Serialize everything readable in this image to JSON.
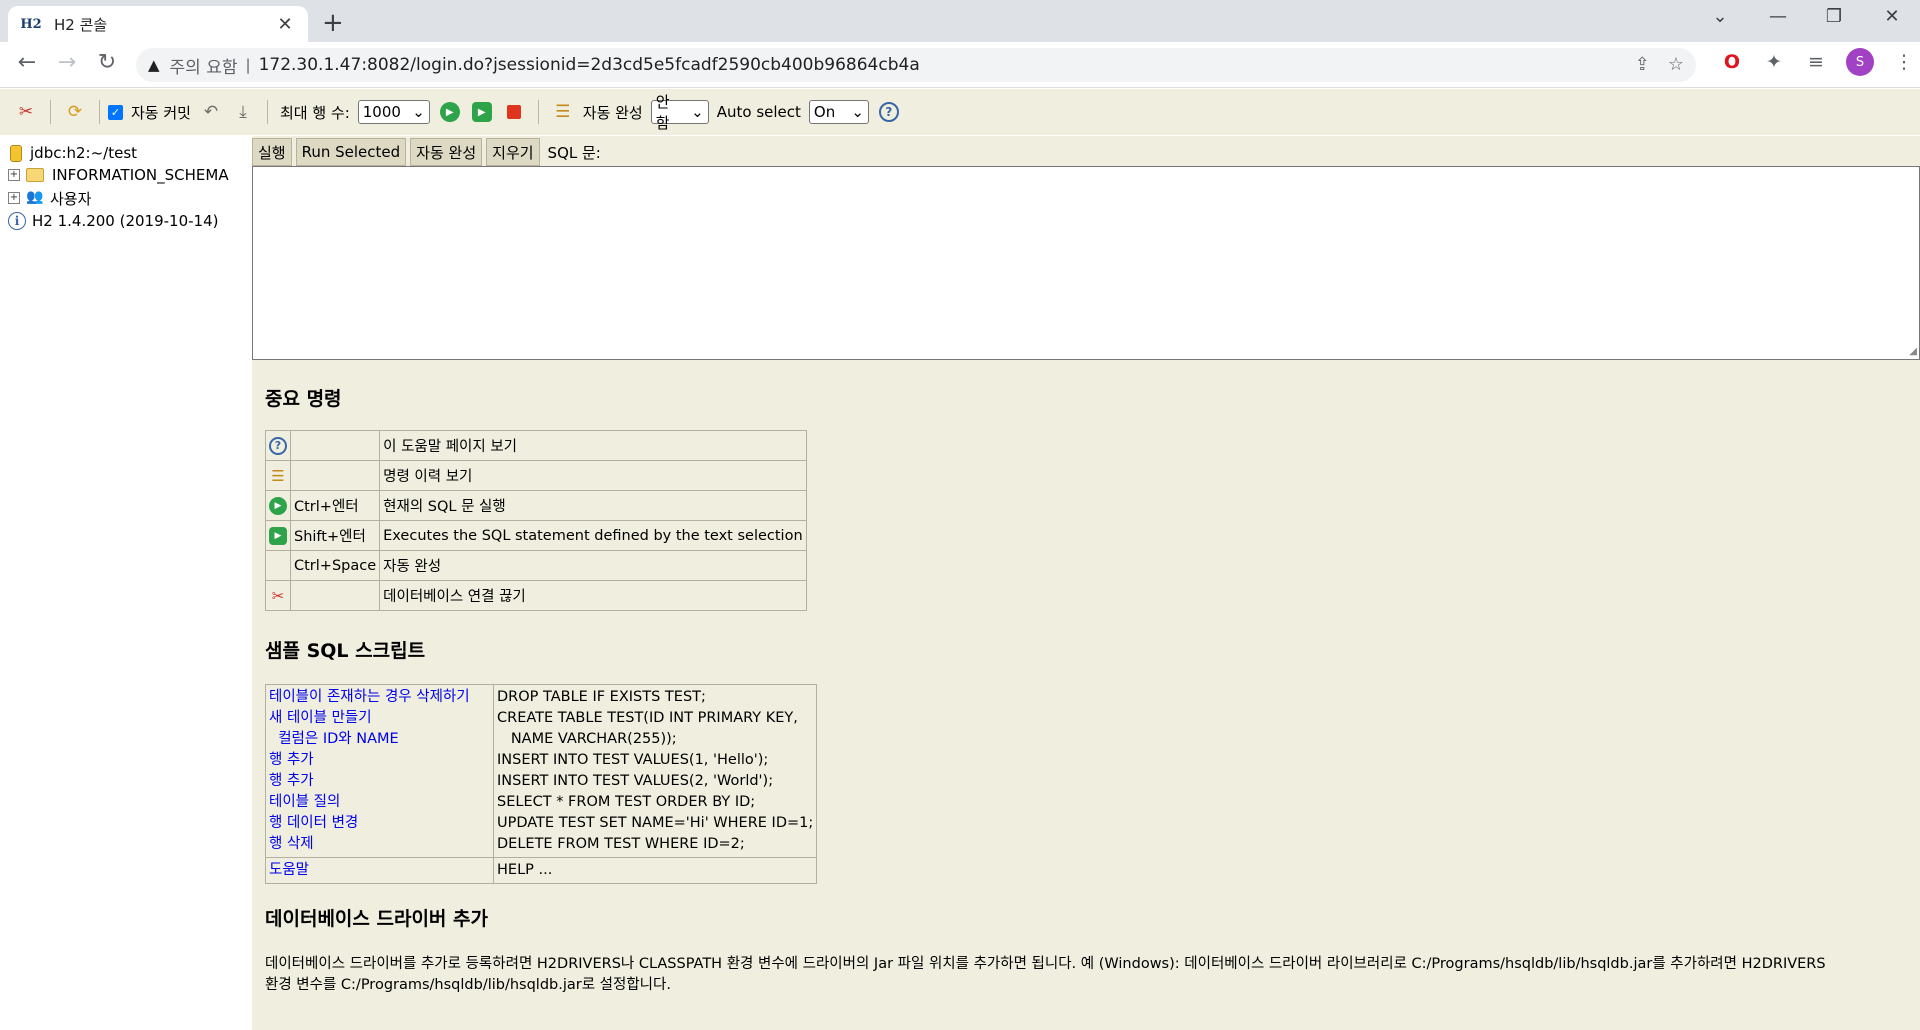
{
  "browser": {
    "tab_title": "H2 콘솔",
    "tab_favicon": "H2",
    "security_label": "주의 요함",
    "url": "172.30.1.47:8082/login.do?jsessionid=2d3cd5e5fcadf2590cb400b96864cb4a",
    "profile_initial": "S"
  },
  "toolbar": {
    "autocommit_label": "자동 커밋",
    "max_rows_label": "최대 행 수:",
    "max_rows_value": "1000",
    "autocomplete_label": "자동 완성",
    "autocomplete_value": "안함",
    "autoselect_label": "Auto select",
    "autoselect_value": "On"
  },
  "tree": {
    "connection": "jdbc:h2:~/test",
    "schema": "INFORMATION_SCHEMA",
    "users": "사용자",
    "version": "H2 1.4.200 (2019-10-14)"
  },
  "editor": {
    "run_label": "실행",
    "run_selected_label": "Run Selected",
    "autocomplete_label": "자동 완성",
    "clear_label": "지우기",
    "sql_label": "SQL 문:",
    "sql_text": ""
  },
  "important": {
    "title": "중요 명령",
    "rows": [
      {
        "icon": "help-icon",
        "key": "",
        "desc": "이 도움말 페이지 보기"
      },
      {
        "icon": "history-icon",
        "key": "",
        "desc": "명령 이력 보기"
      },
      {
        "icon": "run-icon",
        "key": "Ctrl+엔터",
        "desc": "현재의 SQL 문 실행"
      },
      {
        "icon": "run-selected-icon",
        "key": "Shift+엔터",
        "desc": "Executes the SQL statement defined by the text selection"
      },
      {
        "icon": "",
        "key": "Ctrl+Space",
        "desc": "자동 완성"
      },
      {
        "icon": "disconnect-icon",
        "key": "",
        "desc": "데이터베이스 연결 끊기"
      }
    ]
  },
  "samples": {
    "title": "샘플 SQL 스크립트",
    "rows": [
      {
        "label": "테이블이 존재하는 경우 삭제하기",
        "sql": "DROP TABLE IF EXISTS TEST;"
      },
      {
        "label": "새 테이블 만들기",
        "sql": "CREATE TABLE TEST(ID INT PRIMARY KEY,"
      },
      {
        "label": "  컬럼은 ID와 NAME",
        "sql": "   NAME VARCHAR(255));"
      },
      {
        "label": "행 추가",
        "sql": "INSERT INTO TEST VALUES(1, 'Hello');"
      },
      {
        "label": "행 추가",
        "sql": "INSERT INTO TEST VALUES(2, 'World');"
      },
      {
        "label": "테이블 질의",
        "sql": "SELECT * FROM TEST ORDER BY ID;"
      },
      {
        "label": "행 데이터 변경",
        "sql": "UPDATE TEST SET NAME='Hi' WHERE ID=1;"
      },
      {
        "label": "행 삭제",
        "sql": "DELETE FROM TEST WHERE ID=2;"
      }
    ],
    "help_label": "도움말",
    "help_sql": "HELP ..."
  },
  "driver": {
    "title": "데이터베이스 드라이버 추가",
    "line1": "데이터베이스 드라이버를 추가로 등록하려면 H2DRIVERS나 CLASSPATH 환경 변수에 드라이버의 Jar 파일 위치를 추가하면 됩니다. 예 (Windows): 데이터베이스 드라이버 라이브러리로 C:/Programs/hsqldb/lib/hsqldb.jar를 추가하려면 H2DRIVERS",
    "line2": "환경 변수를 C:/Programs/hsqldb/lib/hsqldb.jar로 설정합니다."
  }
}
